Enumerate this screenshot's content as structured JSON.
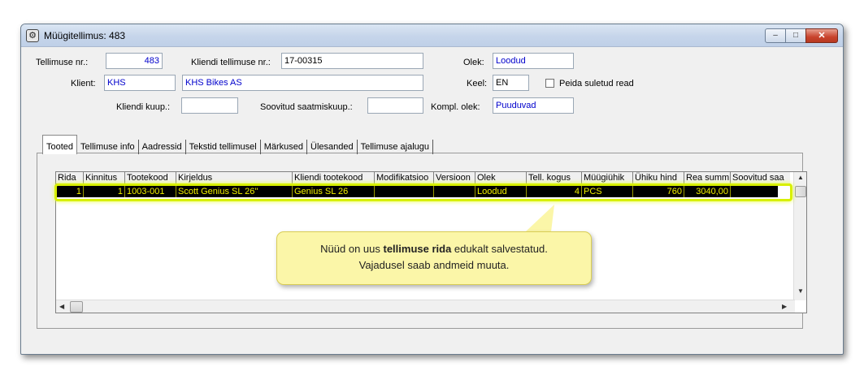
{
  "window": {
    "title": "Müügitellimus: 483",
    "controls": {
      "minimize": "–",
      "maximize": "□",
      "close": "✕"
    }
  },
  "form": {
    "order_no_label": "Tellimuse nr.:",
    "order_no": "483",
    "client_order_no_label": "Kliendi tellimuse nr.:",
    "client_order_no": "17-00315",
    "status_label": "Olek:",
    "status": "Loodud",
    "client_label": "Klient:",
    "client_code": "KHS",
    "client_name": "KHS Bikes AS",
    "language_label": "Keel:",
    "language": "EN",
    "hide_closed_label": "Peida suletud read",
    "client_date_label": "Kliendi kuup.:",
    "client_date": "",
    "desired_delivery_label": "Soovitud saatmiskuup.:",
    "desired_delivery": "",
    "compl_status_label": "Kompl. olek:",
    "compl_status": "Puuduvad"
  },
  "tabs": [
    {
      "label": "Tooted"
    },
    {
      "label": "Tellimuse info"
    },
    {
      "label": "Aadressid"
    },
    {
      "label": "Tekstid tellimusel"
    },
    {
      "label": "Märkused"
    },
    {
      "label": "Ülesanded"
    },
    {
      "label": "Tellimuse ajalugu"
    }
  ],
  "grid": {
    "columns": [
      "Rida",
      "Kinnitus",
      "Tootekood",
      "Kirjeldus",
      "Kliendi tootekood",
      "Modifikatsioo",
      "Versioon",
      "Olek",
      "Tell. kogus",
      "Müügiühik",
      "Ühiku hind",
      "Rea summ",
      "Soovitud saa"
    ],
    "row": {
      "rida": "1",
      "kinnitus": "1",
      "tootekood": "1003-001",
      "kirjeldus": "Scott Genius SL 26''",
      "kliendi_tootekood": "Genius SL 26",
      "modifikatsioon": "",
      "versioon": "",
      "olek": "Loodud",
      "kogus": "4",
      "muugiuhik": "PCS",
      "uhiku_hind": "760",
      "rea_summa": "3040,00",
      "soovitud": ""
    },
    "highlight_color": "#d8f000"
  },
  "callout": {
    "prefix": "Nüüd on uus ",
    "bold": "tellimuse rida",
    "suffix": " edukalt salvestatud.",
    "line2": "Vajadusel saab andmeid muuta."
  }
}
